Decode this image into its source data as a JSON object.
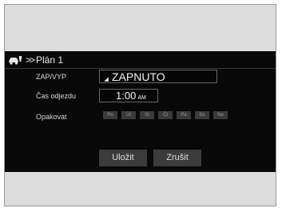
{
  "header": {
    "title": "Plán 1"
  },
  "rows": {
    "status_label": "ZAP/VYP",
    "status_value": "ZAPNUTO",
    "time_label": "Čas odjezdu",
    "time_value": "1:00",
    "time_ampm": "AM",
    "repeat_label": "Opakovat"
  },
  "days": [
    "Po",
    "Út",
    "St",
    "Čt",
    "Pá",
    "So",
    "Ne"
  ],
  "buttons": {
    "save": "Uložit",
    "cancel": "Zrušit"
  }
}
